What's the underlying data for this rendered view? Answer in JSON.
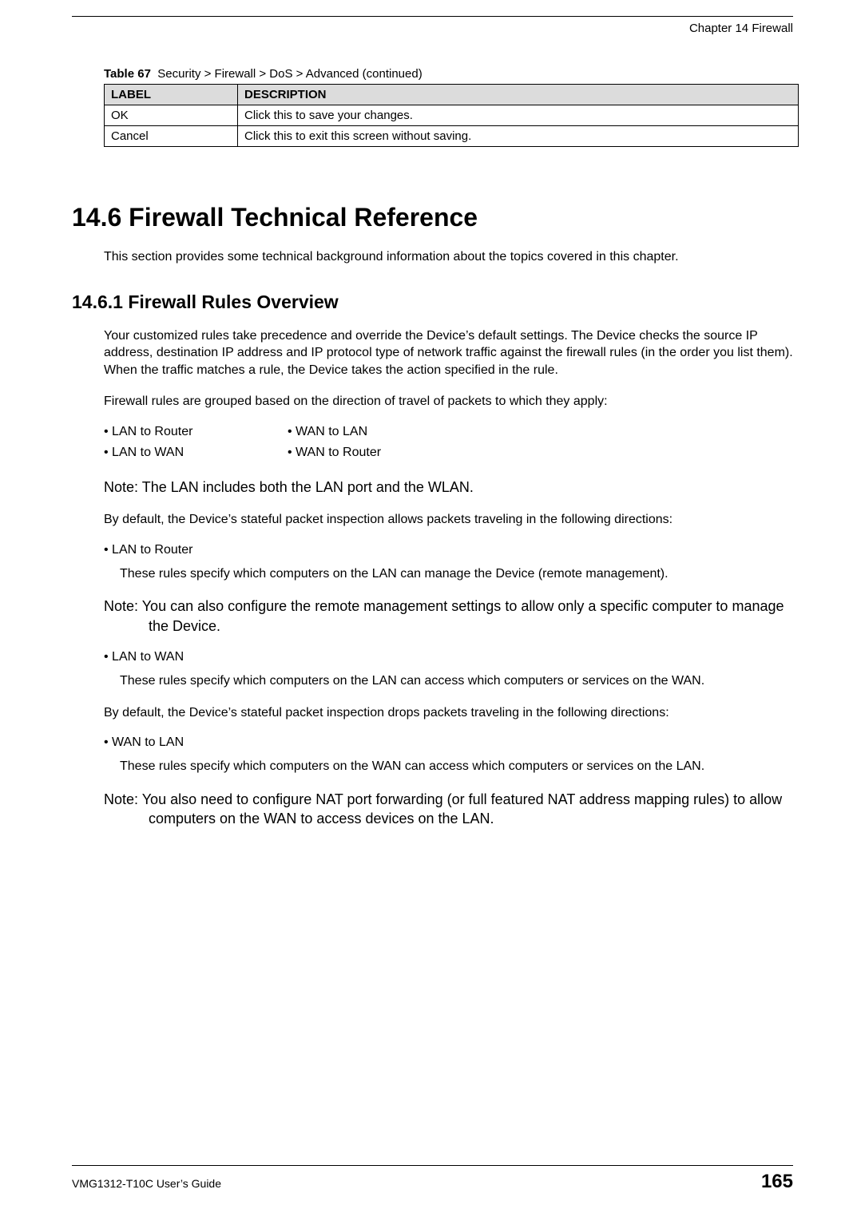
{
  "header": {
    "chapter": "Chapter 14 Firewall"
  },
  "table": {
    "caption_label": "Table 67",
    "caption_text": "Security > Firewall > DoS > Advanced (continued)",
    "col_label": "LABEL",
    "col_desc": "DESCRIPTION",
    "rows": [
      {
        "label": "OK",
        "desc": "Click this to save your changes."
      },
      {
        "label": "Cancel",
        "desc": "Click this to exit this screen without saving."
      }
    ]
  },
  "section_14_6": {
    "heading": "14.6  Firewall Technical Reference",
    "intro": "This section provides some technical background information about the topics covered in this chapter."
  },
  "section_14_6_1": {
    "heading": "14.6.1  Firewall Rules Overview",
    "para1": "Your customized rules take precedence and override the Device’s default settings. The Device checks the source IP address, destination IP address and IP protocol type of network traffic against the firewall rules (in the order you list them). When the traffic matches a rule, the Device takes the action specified in the rule.",
    "para2": "Firewall rules are grouped based on the direction of travel of packets to which they apply:",
    "directions": {
      "r1c1": "•  LAN to Router",
      "r1c2": "•  WAN to LAN",
      "r2c1": "•  LAN to WAN",
      "r2c2": "•  WAN to Router"
    },
    "note1": "Note: The LAN includes both the LAN port and the WLAN.",
    "para3": "By default, the Device’s stateful packet inspection allows packets traveling in the following directions:",
    "bullet_lan_router": "•  LAN to Router",
    "desc_lan_router": "These rules specify which computers on the LAN can manage the Device (remote management).",
    "note2": "Note: You can also configure the remote management settings to allow only a specific computer to manage the Device.",
    "bullet_lan_wan": "•  LAN to WAN",
    "desc_lan_wan": "These rules specify which computers on the LAN can access which computers or services on the WAN.",
    "para4": "By default, the Device’s stateful packet inspection drops packets traveling in the following directions:",
    "bullet_wan_lan": "•  WAN to LAN",
    "desc_wan_lan": "These rules specify which computers on the WAN can access which computers or services on the LAN.",
    "note3": "Note: You also need to configure NAT port forwarding (or full featured NAT address mapping rules) to allow computers on the WAN to access devices on the LAN."
  },
  "footer": {
    "guide": "VMG1312-T10C User’s Guide",
    "page": "165"
  }
}
